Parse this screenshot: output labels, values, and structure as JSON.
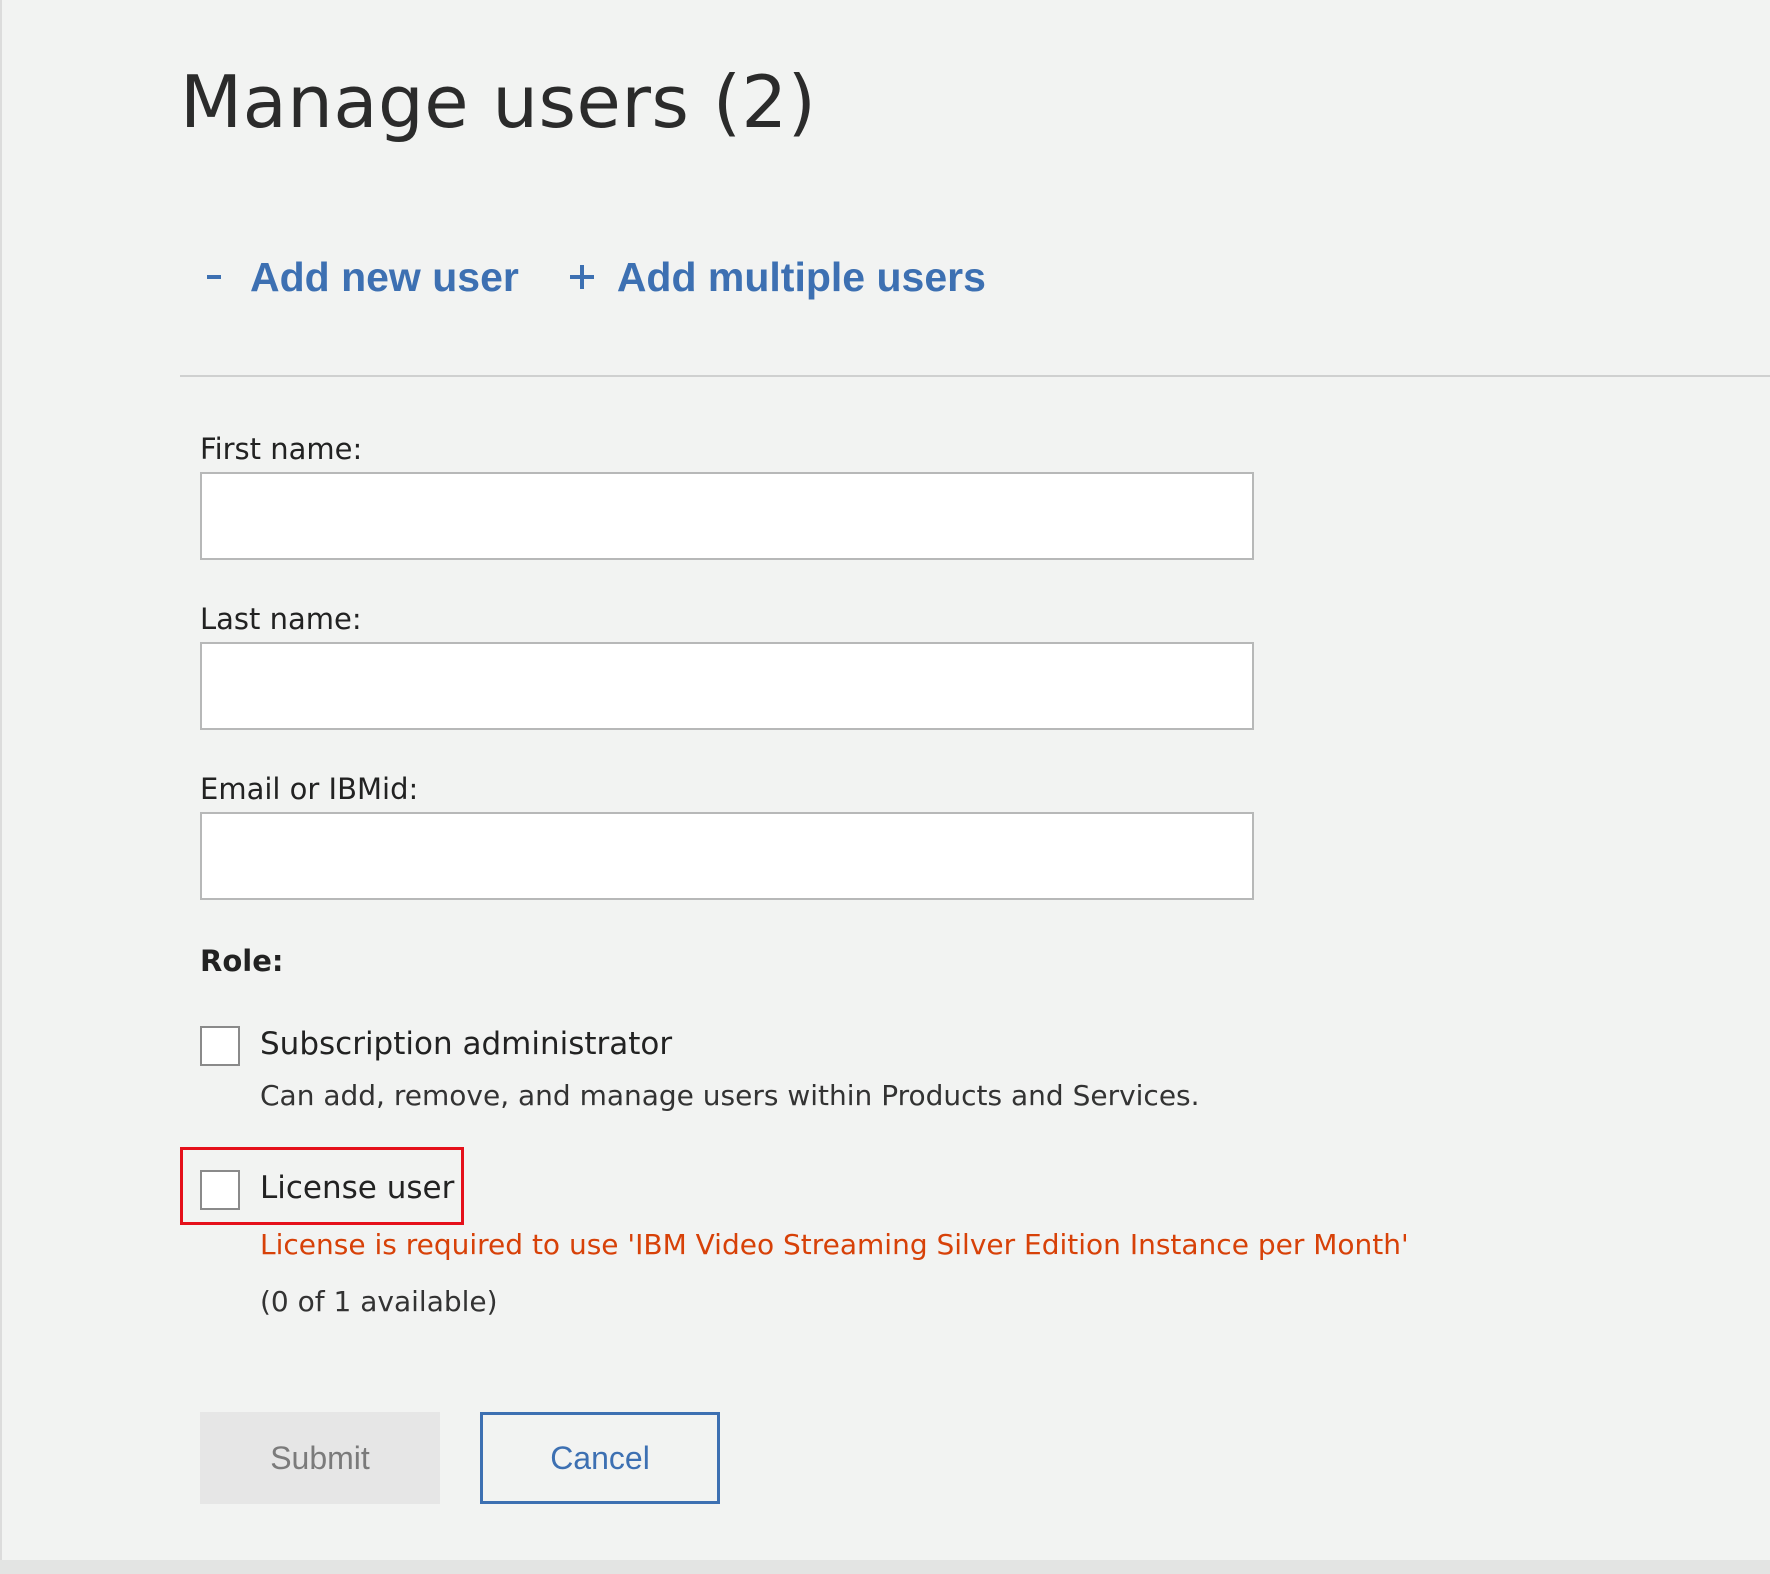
{
  "page": {
    "title": "Manage users (2)"
  },
  "actions": {
    "add_new_user": {
      "icon": "minus-icon",
      "symbol": "-",
      "label": "Add new user"
    },
    "add_multiple_users": {
      "icon": "plus-icon",
      "symbol": "+",
      "label": "Add multiple users"
    }
  },
  "form": {
    "first_name": {
      "label": "First name:",
      "value": "",
      "placeholder": ""
    },
    "last_name": {
      "label": "Last name:",
      "value": "",
      "placeholder": ""
    },
    "email": {
      "label": "Email or IBMid:",
      "value": "",
      "placeholder": ""
    },
    "role": {
      "label": "Role:",
      "options": [
        {
          "label": "Subscription administrator",
          "description": "Can add, remove, and manage users within Products and Services.",
          "checked": false
        },
        {
          "label": "License user",
          "warning": "License is required to use 'IBM Video Streaming Silver Edition Instance per Month'",
          "availability": "(0 of 1 available)",
          "checked": false
        }
      ]
    }
  },
  "buttons": {
    "submit": "Submit",
    "cancel": "Cancel"
  },
  "colors": {
    "background": "#f2f3f2",
    "link_blue": "#3d70b2",
    "warning_orange": "#d74108",
    "highlight_red": "#e5101a"
  }
}
